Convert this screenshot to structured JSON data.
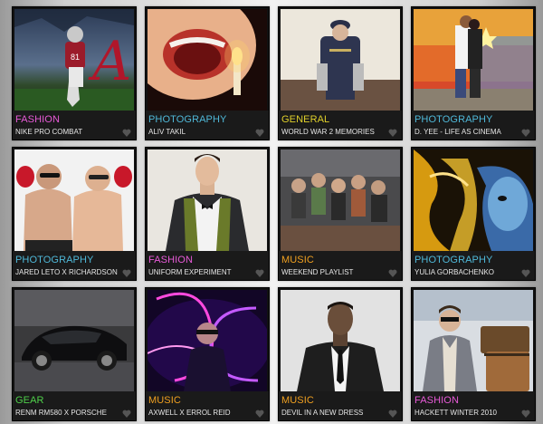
{
  "colors": {
    "FASHION": "#e85ad8",
    "PHOTOGRAPHY": "#4fb8d8",
    "GENERAL": "#e0d02a",
    "MUSIC": "#f0a020",
    "GEAR": "#4fd04a"
  },
  "tiles": [
    {
      "category": "FASHION",
      "title": "NIKE PRO COMBAT",
      "image": "football-player-alabama-photo"
    },
    {
      "category": "PHOTOGRAPHY",
      "title": "ALIV TAKIL",
      "image": "open-mouth-candle-photo"
    },
    {
      "category": "GENERAL",
      "title": "WORLD WAR 2 MEMORIES",
      "image": "veteran-in-uniform-photo"
    },
    {
      "category": "PHOTOGRAPHY",
      "title": "D. YEE - LIFE AS CINEMA",
      "image": "couple-embracing-photo"
    },
    {
      "category": "PHOTOGRAPHY",
      "title": "JARED LETO X RICHARDSON",
      "image": "boxing-men-photo"
    },
    {
      "category": "FASHION",
      "title": "UNIFORM EXPERIMENT",
      "image": "man-in-scarf-photo"
    },
    {
      "category": "MUSIC",
      "title": "WEEKEND PLAYLIST",
      "image": "band-group-photo"
    },
    {
      "category": "PHOTOGRAPHY",
      "title": "YULIA GORBACHENKO",
      "image": "gold-face-art-photo"
    },
    {
      "category": "GEAR",
      "title": "RENM RM580 X PORSCHE",
      "image": "black-porsche-photo"
    },
    {
      "category": "MUSIC",
      "title": "AXWELL X ERROL REID",
      "image": "neon-lights-dj-photo"
    },
    {
      "category": "MUSIC",
      "title": "DEVIL IN A NEW DRESS",
      "image": "man-in-suit-bw-photo"
    },
    {
      "category": "FASHION",
      "title": "HACKETT WINTER 2010",
      "image": "man-with-luggage-photo"
    }
  ]
}
